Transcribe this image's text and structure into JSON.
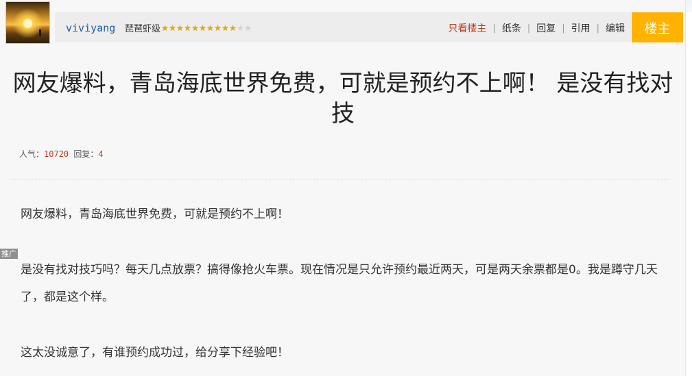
{
  "post": {
    "username": "viviyang",
    "level_label": "琵琶虾级",
    "stars": {
      "filled": 10,
      "total": 12
    },
    "actions": [
      "只看楼主",
      "纸条",
      "回复",
      "引用",
      "编辑"
    ],
    "owner_badge": "楼主",
    "title": "网友爆料，青岛海底世界免费，可就是预约不上啊！ 是没有找对技",
    "stats": {
      "views_label": "人气：",
      "views": "10720",
      "replies_label": "回复：",
      "replies": "4"
    },
    "promo_tag": "推广",
    "paragraphs": [
      "网友爆料，青岛海底世界免费，可就是预约不上啊！",
      "是没有找对技巧吗？每天几点放票？搞得像抢火车票。现在情况是只允许预约最近两天，可是两天余票都是0。我是蹲守几天了，都是这个样。",
      "这太没诚意了，有谁预约成功过，给分享下经验吧！"
    ]
  },
  "colors": {
    "accent_orange": "#ffb300",
    "link_blue": "#1d5fa3",
    "highlight_red": "#c5381a"
  }
}
